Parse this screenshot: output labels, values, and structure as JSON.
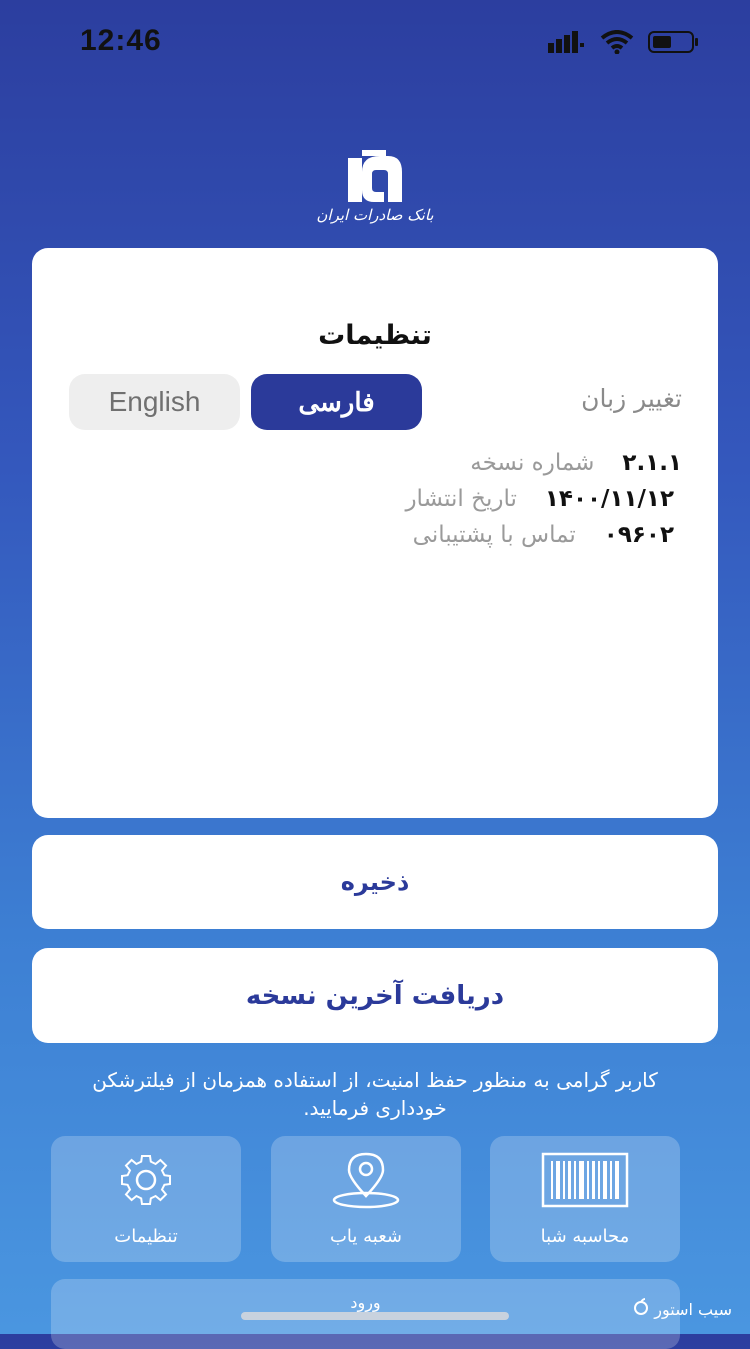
{
  "status_bar": {
    "time": "12:46",
    "icons": [
      "signal-icon",
      "wifi-icon",
      "battery-icon"
    ]
  },
  "logo": {
    "text": "بانک صادرات ایران"
  },
  "settings": {
    "title": "تنظیمات",
    "language_label": "تغییر زبان",
    "language_options": {
      "farsi": "فارسی",
      "english": "English"
    },
    "selected_language": "فارسی",
    "info": [
      {
        "label": "شماره نسخه",
        "value": "۲.۱.۱"
      },
      {
        "label": "تاریخ انتشار",
        "value": "۱۴۰۰/۱۱/۱۲"
      },
      {
        "label": "تماس با پشتیبانی",
        "value": "۰۹۶۰۲"
      }
    ]
  },
  "buttons": {
    "save": "ذخیره",
    "get_latest": "دریافت آخرین نسخه"
  },
  "security_note": "کاربر گرامی به منظور حفظ امنیت، از استفاده همزمان از فیلترشکن خودداری فرمایید.",
  "shortcuts": [
    {
      "label": "تنظیمات",
      "icon": "gear-icon"
    },
    {
      "label": "شعبه یاب",
      "icon": "location-pin-icon"
    },
    {
      "label": "محاسبه شبا",
      "icon": "barcode-icon"
    }
  ],
  "login": "ورود",
  "watermark": "سیب استور",
  "colors": {
    "primary": "#2b3a9a",
    "gradient_top": "#2c3e9f",
    "gradient_bottom": "#4a96e0"
  }
}
